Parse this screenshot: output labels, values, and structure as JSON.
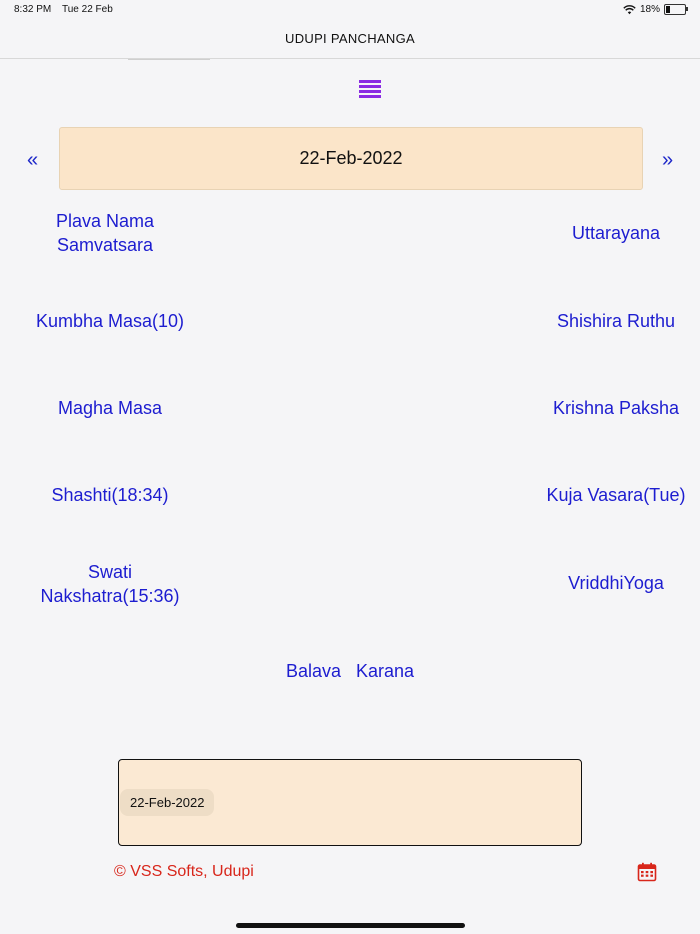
{
  "status_bar": {
    "time": "8:32 PM",
    "date": "Tue 22 Feb",
    "battery": "18%",
    "battery_level": 0.18
  },
  "header": {
    "title": "UDUPI PANCHANGA"
  },
  "nav": {
    "prev": "«",
    "next": "»",
    "current_date": "22-Feb-2022"
  },
  "panchanga": {
    "samvatsara_line1": "Plava Nama",
    "samvatsara_line2": "Samvatsara",
    "ayana": "Uttarayana",
    "solar_masa": "Kumbha Masa(10)",
    "ruthu": "Shishira Ruthu",
    "lunar_masa": "Magha Masa",
    "paksha": "Krishna Paksha",
    "tithi": "Shashti(18:34)",
    "vasara": "Kuja Vasara(Tue)",
    "nakshatra_line1": "Swati",
    "nakshatra_line2": "Nakshatra(15:36)",
    "yoga": "VriddhiYoga",
    "karana": "Balava   Karana"
  },
  "date_picker": {
    "value": "22-Feb-2022"
  },
  "footer": {
    "copyright": "© VSS Softs, Udupi"
  },
  "colors": {
    "accent": "#1d1dd0",
    "menu": "#8a2be2",
    "date_box": "#fbe5c9",
    "footer": "#d8261b"
  },
  "icons": {
    "menu": "hamburger-icon",
    "calendar": "calendar-icon",
    "wifi": "wifi-icon",
    "battery": "battery-icon"
  }
}
